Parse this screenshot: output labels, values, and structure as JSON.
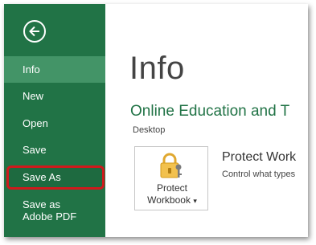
{
  "sidebar": {
    "back_icon": "back-arrow-icon",
    "items": [
      {
        "label": "Info",
        "active": true
      },
      {
        "label": "New"
      },
      {
        "label": "Open"
      },
      {
        "label": "Save"
      },
      {
        "label": "Save As",
        "highlighted": true
      },
      {
        "label": "Save as Adobe PDF"
      }
    ]
  },
  "main": {
    "title": "Info",
    "doc_name": "Online Education and T",
    "doc_path": "Desktop",
    "protect": {
      "button_line1": "Protect",
      "button_line2": "Workbook",
      "dropdown_glyph": "▾",
      "heading": "Protect Work",
      "description": "Control what types",
      "icon": "lock-key-icon"
    }
  },
  "colors": {
    "sidebar": "#217346",
    "active": "#439467",
    "highlight_border": "#d0191c"
  }
}
